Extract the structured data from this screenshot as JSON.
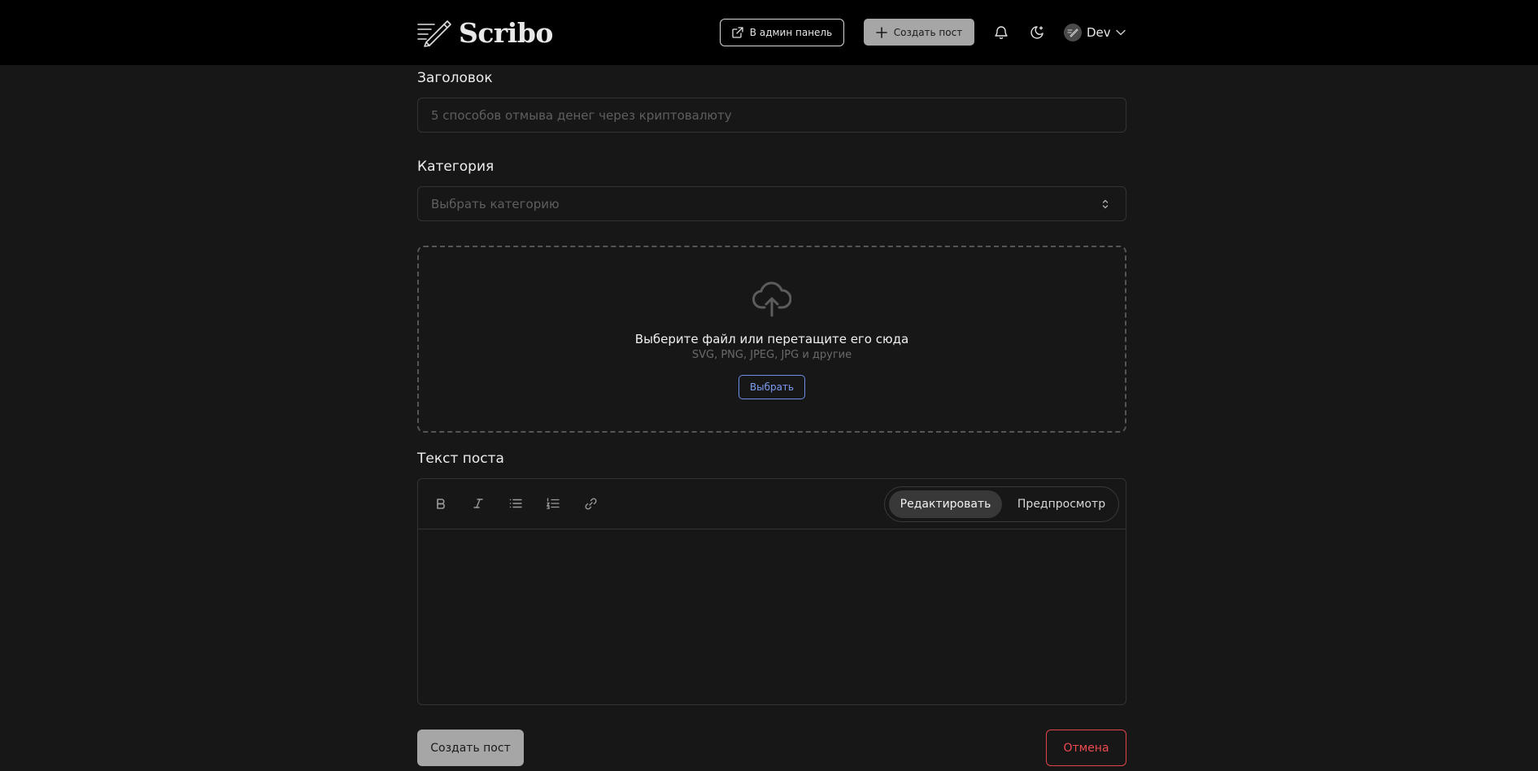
{
  "header": {
    "brand": "Scribo",
    "admin_label": "В админ панель",
    "create_label": "Создать пост",
    "user_name": "Dev"
  },
  "form": {
    "title_label": "Заголовок",
    "title_placeholder": "5 способов отмыва денег через криптовалюту",
    "category_label": "Категория",
    "category_placeholder": "Выбрать категорию",
    "upload": {
      "title": "Выберите файл или перетащите его сюда",
      "subtitle": "SVG, PNG, JPEG, JPG и другие",
      "button": "Выбрать"
    },
    "text_label": "Текст поста",
    "editor": {
      "tools": [
        "bold-icon",
        "italic-icon",
        "bullet-list-icon",
        "numbered-list-icon",
        "link-icon"
      ],
      "mode_edit": "Редактировать",
      "mode_preview": "Предпросмотр",
      "active_mode": "edit"
    },
    "submit_label": "Создать пост",
    "cancel_label": "Отмена"
  },
  "colors": {
    "background": "#171717",
    "header": "#000000",
    "primary_button": "#a6a6a6",
    "accent_blue": "#7c9cf0",
    "danger": "#ee4a50"
  }
}
